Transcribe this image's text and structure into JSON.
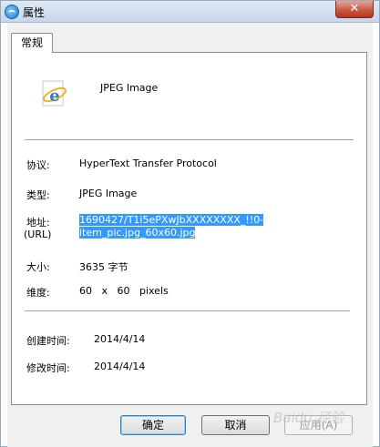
{
  "window": {
    "title": "属性",
    "close_label": "✕"
  },
  "tabs": [
    {
      "label": "常规"
    }
  ],
  "file": {
    "type_label": "JPEG Image"
  },
  "properties": [
    {
      "label": "协议:",
      "value": "HyperText Transfer Protocol"
    },
    {
      "label": "类型:",
      "value": "JPEG Image"
    },
    {
      "label": "地址:",
      "label2": "(URL)",
      "value_line1": "1690427/T1i5ePXwJbXXXXXXXX_!!0-",
      "value_line2": "item_pic.jpg_60x60.jpg"
    },
    {
      "label": "大小:",
      "value": "3635 字节"
    },
    {
      "label": "维度:",
      "value": "60   x   60   pixels"
    },
    {
      "label": "创建时间:",
      "value": "2014/4/14"
    },
    {
      "label": "修改时间:",
      "value": "2014/4/14"
    }
  ],
  "buttons": {
    "ok": "确定",
    "cancel": "取消",
    "apply": "应用(A)"
  },
  "watermark": "Baidu 经验",
  "icons": {
    "app": "browser-icon",
    "file": "internet-explorer-icon"
  }
}
